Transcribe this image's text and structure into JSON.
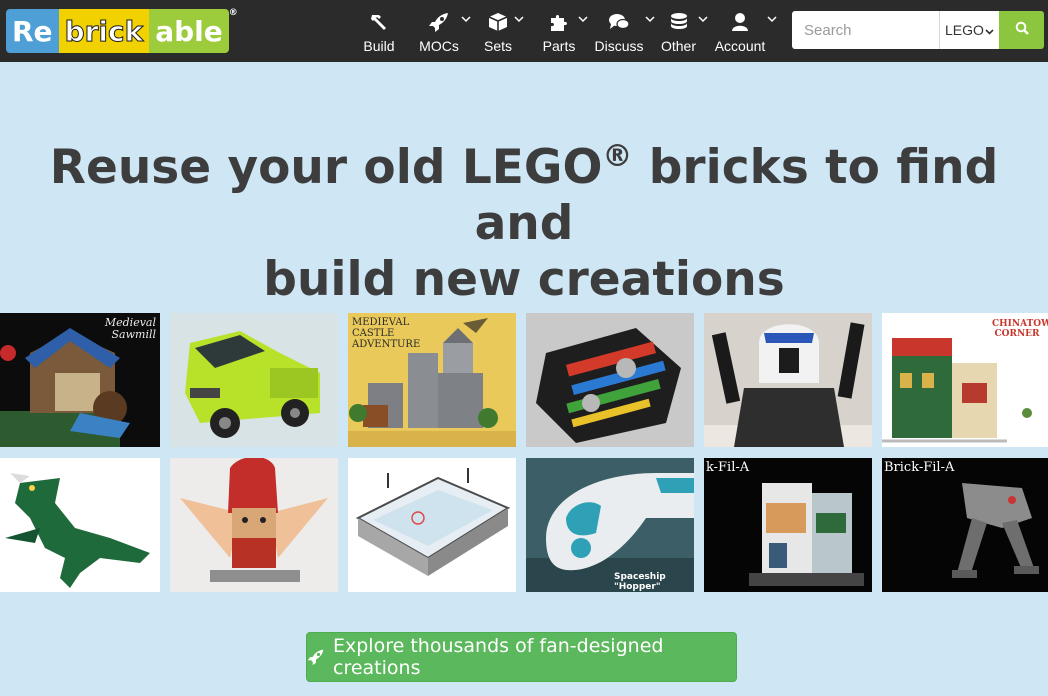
{
  "logo": {
    "part1": "Re",
    "part2": "brick",
    "part3": "able",
    "reg": "®"
  },
  "nav": [
    {
      "label": "Build",
      "icon": "hammer-icon",
      "dropdown": false
    },
    {
      "label": "MOCs",
      "icon": "rocket-icon",
      "dropdown": true
    },
    {
      "label": "Sets",
      "icon": "cube-icon",
      "dropdown": true
    },
    {
      "label": "Parts",
      "icon": "puzzle-icon",
      "dropdown": true
    },
    {
      "label": "Discuss",
      "icon": "comments-icon",
      "dropdown": true
    },
    {
      "label": "Other",
      "icon": "database-icon",
      "dropdown": true
    },
    {
      "label": "Account",
      "icon": "user-icon",
      "dropdown": true
    }
  ],
  "search": {
    "placeholder": "Search",
    "scope": "LEGO",
    "button_icon": "search-icon"
  },
  "hero": {
    "line1_a": "Reuse your old LEGO",
    "line1_sup": "®",
    "line1_b": " bricks to find and",
    "line2": "build new creations"
  },
  "gallery": [
    {
      "caption": "Medieval Sawmill"
    },
    {
      "caption": ""
    },
    {
      "caption": "MEDIEVAL CASTLE ADVENTURE"
    },
    {
      "caption": ""
    },
    {
      "caption": ""
    },
    {
      "caption": "CHINATOWN CORNER"
    },
    {
      "caption": ""
    },
    {
      "caption": ""
    },
    {
      "caption": ""
    },
    {
      "caption": "Spaceship \"Hopper\""
    },
    {
      "caption": "k-Fil-A"
    },
    {
      "caption": "Brick-Fil-A"
    }
  ],
  "cta": {
    "label": "Explore thousands of fan-designed creations",
    "icon": "rocket-icon"
  },
  "colors": {
    "navbar": "#2b2b2b",
    "background": "#cfe6f5",
    "cta": "#5cb85c",
    "search_button": "#8cc63f",
    "logo_blue": "#4f9fd7",
    "logo_yellow": "#f2d100",
    "logo_green": "#9ccb3b"
  }
}
